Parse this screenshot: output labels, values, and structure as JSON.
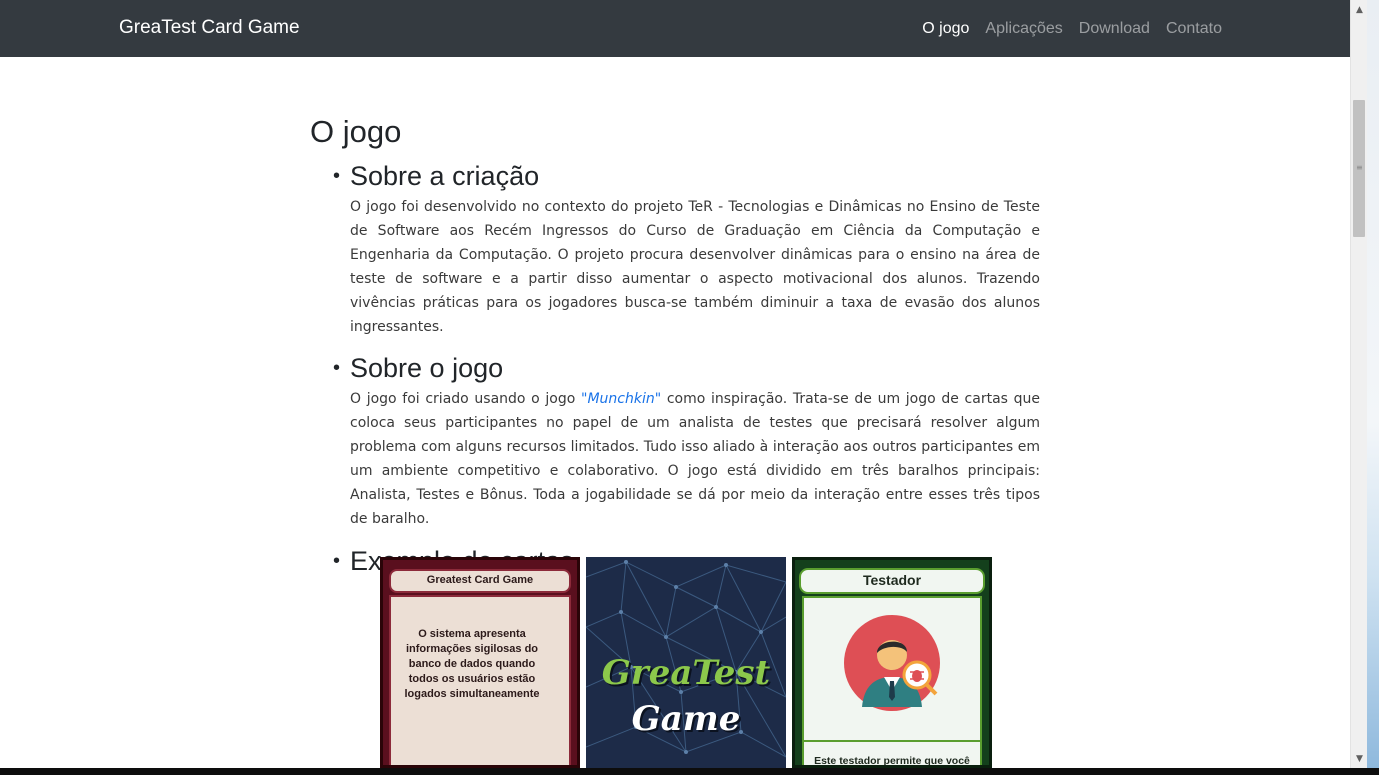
{
  "navbar": {
    "brand": "GreaTest Card Game",
    "links": [
      "O jogo",
      "Aplicações",
      "Download",
      "Contato"
    ],
    "active": "O jogo"
  },
  "main": {
    "title": "O jogo",
    "sections": [
      {
        "title": "Sobre a criação",
        "text": "O jogo foi desenvolvido no contexto do projeto TeR - Tecnologias e Dinâmicas no Ensino de Teste de Software aos Recém Ingressos do Curso de Graduação em Ciência da Computação e Engenharia da Computação. O projeto procura desenvolver dinâmicas para o ensino na área de teste de software e a partir disso aumentar o aspecto motivacional dos alunos. Trazendo vivências práticas para os jogadores busca-se também diminuir a taxa de evasão dos alunos ingressantes."
      },
      {
        "title": "Sobre o jogo",
        "text_before": "O jogo foi criado usando o jogo ",
        "link": "\"Munchkin\"",
        "text_after": " como inspiração. Trata-se de um jogo de cartas que coloca seus participantes no papel de um analista de testes que precisará resolver algum problema com alguns recursos limitados. Tudo isso aliado à interação aos outros participantes em um ambiente competitivo e colaborativo. O jogo está dividido em três baralhos principais: Analista, Testes e Bônus. Toda a jogabilidade se dá por meio da interação entre esses três tipos de baralho."
      },
      {
        "title": "Exemplo de cartas"
      }
    ],
    "cards": [
      {
        "header": "Greatest Card Game",
        "text": "O sistema apresenta informações sigilosas do banco de dados quando todos os usuários estão logados simultaneamente"
      },
      {
        "logo_line1": "GreaTest",
        "logo_line2": "Game"
      },
      {
        "header": "Testador",
        "text": "Este testador permite que você"
      }
    ]
  },
  "colors": {
    "navbar_bg": "#343a40",
    "link": "#1a73e8",
    "card_red": "#5a0f1e",
    "card_blue": "#1d2b48",
    "card_green": "#14401c"
  },
  "icons": [
    "bullet-icon",
    "user-bug-icon",
    "scroll-up-icon",
    "scroll-down-icon"
  ]
}
